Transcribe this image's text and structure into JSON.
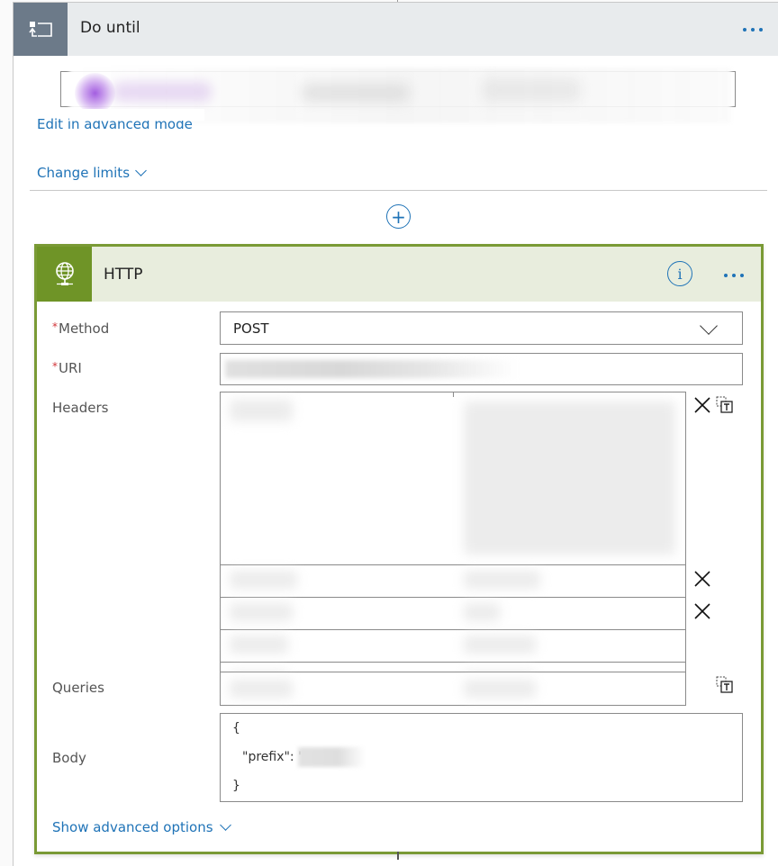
{
  "do_until": {
    "title": "Do until",
    "icon": "loop-icon",
    "more_icon": "more-options-icon",
    "edit_advanced_label": "Edit in advanced mode",
    "change_limits_label": "Change limits"
  },
  "add_step": {
    "icon": "plus-circle-icon"
  },
  "http_action": {
    "title": "HTTP",
    "icon": "globe-icon",
    "info_icon": "info-icon",
    "more_icon": "more-options-icon",
    "accent_color": "#6f9427",
    "fields": {
      "method": {
        "label": "Method",
        "required": "*",
        "value": "POST"
      },
      "uri": {
        "label": "URI",
        "required": "*",
        "value": ""
      },
      "headers": {
        "label": "Headers"
      },
      "queries": {
        "label": "Queries"
      },
      "body": {
        "label": "Body",
        "lines": [
          "{",
          "\"prefix\": '",
          "}"
        ]
      }
    },
    "show_advanced_label": "Show advanced options"
  },
  "colors": {
    "link": "#1f73b7",
    "do_until_icon_bg": "#6c7a89",
    "do_until_header_bg": "#e8ebed",
    "http_header_bg": "#e8eddd",
    "http_border": "#7a9a35",
    "required_star": "#d13438"
  }
}
